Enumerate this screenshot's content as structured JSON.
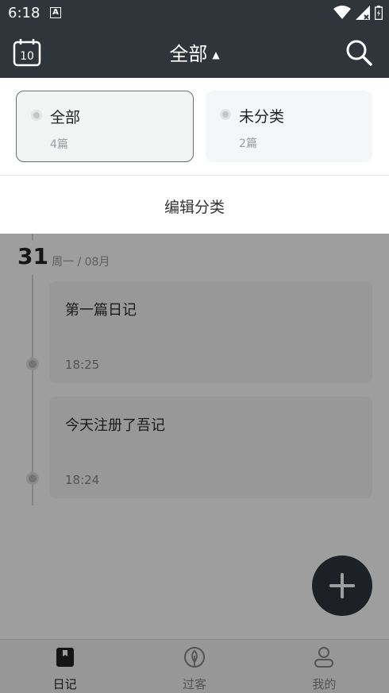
{
  "status_bar": {
    "time": "6:18",
    "notification_letter": "A"
  },
  "header": {
    "title": "全部",
    "calendar_day": "10"
  },
  "categories": [
    {
      "name": "全部",
      "count": "4篇",
      "selected": true
    },
    {
      "name": "未分类",
      "count": "2篇",
      "selected": false
    }
  ],
  "edit_category_label": "编辑分类",
  "timeline": {
    "day": "31",
    "meta": "周一 / 08月",
    "entries": [
      {
        "title": "第一篇日记",
        "time": "18:25"
      },
      {
        "title": "今天注册了吾记",
        "time": "18:24"
      }
    ]
  },
  "bottom_nav": [
    {
      "label": "日记",
      "icon": "diary-icon",
      "active": true
    },
    {
      "label": "过客",
      "icon": "leaf-icon",
      "active": false
    },
    {
      "label": "我的",
      "icon": "person-icon",
      "active": false
    }
  ],
  "colors": {
    "header_bg": "#2f353a",
    "overlay": "rgba(0,0,0,0.38)"
  }
}
